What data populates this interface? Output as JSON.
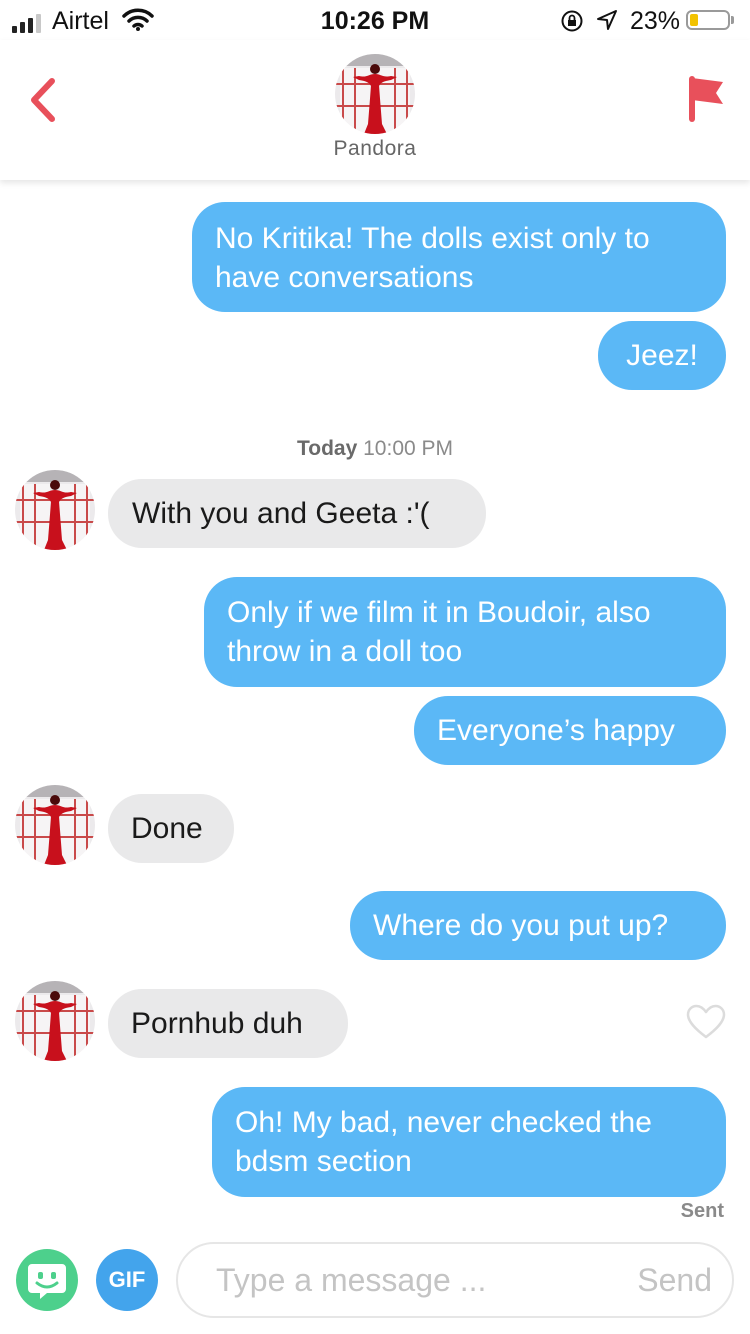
{
  "status_bar": {
    "carrier": "Airtel",
    "time": "10:26 PM",
    "battery_percent": "23%",
    "battery_level": 0.23,
    "battery_color": "#f2c200"
  },
  "header": {
    "back_icon": "chevron-left-icon",
    "report_icon": "flag-icon",
    "contact_name": "Pandora"
  },
  "colors": {
    "outgoing_bubble": "#5bb8f6",
    "incoming_bubble": "#e9e9ea",
    "accent_red": "#e8505b",
    "emoji_button": "#4dd08c",
    "gif_button": "#43a4ec"
  },
  "messages": [
    {
      "direction": "out",
      "text": "No Kritika! The dolls exist only to have conversations"
    },
    {
      "direction": "out",
      "text": "Jeez!"
    },
    {
      "direction": "in",
      "text": "With you and Geeta :'("
    },
    {
      "direction": "out",
      "text": "Only if we film it in Boudoir, also throw in a doll too"
    },
    {
      "direction": "out",
      "text": "Everyone’s happy"
    },
    {
      "direction": "in",
      "text": "Done"
    },
    {
      "direction": "out",
      "text": "Where do you put up?"
    },
    {
      "direction": "in",
      "text": "Pornhub duh"
    },
    {
      "direction": "out",
      "text": "Oh! My bad, never checked the bdsm section"
    }
  ],
  "timestamp": {
    "day": "Today",
    "time": "10:00 PM"
  },
  "sent_label": "Sent",
  "composer": {
    "emoji_icon": "smiley-face-icon",
    "gif_label": "GIF",
    "placeholder": "Type a message ...",
    "value": "",
    "send_label": "Send"
  }
}
